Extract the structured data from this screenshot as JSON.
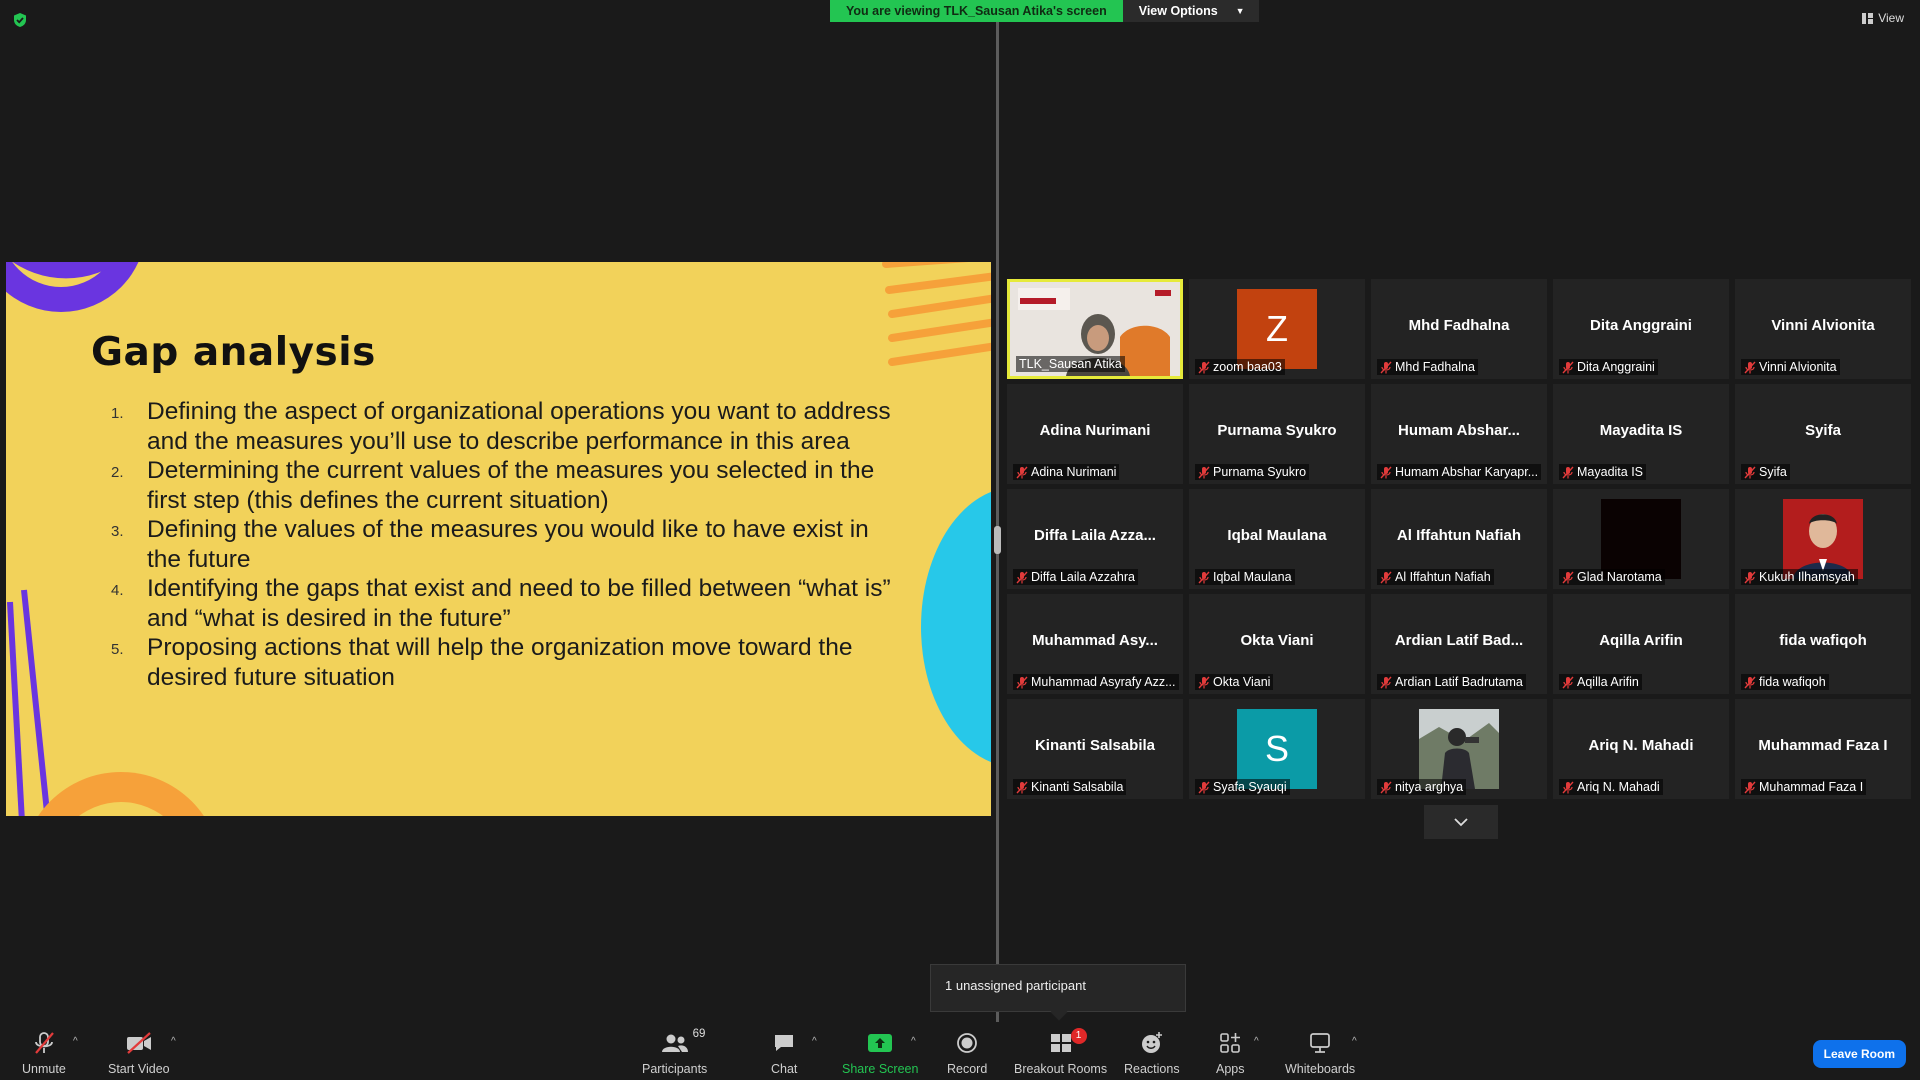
{
  "banner": {
    "viewing_text": "You are viewing TLK_Sausan Atika's screen",
    "view_options": "View Options"
  },
  "top_right": {
    "view_label": "View"
  },
  "slide": {
    "title": "Gap analysis",
    "items": [
      {
        "num": "1.",
        "text": "Defining the aspect of organizational operations you want to address and the measures you’ll use to describe performance in this area"
      },
      {
        "num": "2.",
        "text": "Determining the current values of the measures you selected in the first step (this defines the current situation)"
      },
      {
        "num": "3.",
        "text": "Defining the values of the measures you would like to have exist in the future"
      },
      {
        "num": "4.",
        "text": "Identifying the gaps that exist and need to be filled between “what is” and “what is desired in the future”"
      },
      {
        "num": "5.",
        "text": "Proposing actions that will help the organization move toward the desired future situation"
      }
    ]
  },
  "gallery": {
    "tiles": [
      {
        "big": "",
        "label": "TLK_Sausan Atika",
        "kind": "video"
      },
      {
        "big": "",
        "label": "zoom baa03",
        "kind": "letter",
        "letter": "Z",
        "color": "#c2420f"
      },
      {
        "big": "Mhd Fadhalna",
        "label": "Mhd Fadhalna",
        "kind": "name"
      },
      {
        "big": "Dita Anggraini",
        "label": "Dita Anggraini",
        "kind": "name"
      },
      {
        "big": "Vinni Alvionita",
        "label": "Vinni Alvionita",
        "kind": "name"
      },
      {
        "big": "Adina Nurimani",
        "label": "Adina Nurimani",
        "kind": "name"
      },
      {
        "big": "Purnama Syukro",
        "label": "Purnama Syukro",
        "kind": "name"
      },
      {
        "big": "Humam  Abshar...",
        "label": "Humam Abshar Karyapr...",
        "kind": "name"
      },
      {
        "big": "Mayadita IS",
        "label": "Mayadita IS",
        "kind": "name"
      },
      {
        "big": "Syifa",
        "label": "Syifa",
        "kind": "name"
      },
      {
        "big": "Diffa  Laila  Azza...",
        "label": "Diffa Laila Azzahra",
        "kind": "name"
      },
      {
        "big": "Iqbal Maulana",
        "label": "Iqbal Maulana",
        "kind": "name"
      },
      {
        "big": "Al Iffahtun Nafiah",
        "label": "Al Iffahtun Nafiah",
        "kind": "name"
      },
      {
        "big": "",
        "label": "Glad Narotama",
        "kind": "black"
      },
      {
        "big": "",
        "label": "Kukuh Ilhamsyah",
        "kind": "photo-red"
      },
      {
        "big": "Muhammad  Asy...",
        "label": "Muhammad Asyrafy Azz...",
        "kind": "name"
      },
      {
        "big": "Okta Viani",
        "label": "Okta Viani",
        "kind": "name"
      },
      {
        "big": "Ardian  Latif  Bad...",
        "label": "Ardian Latif Badrutama",
        "kind": "name"
      },
      {
        "big": "Aqilla Arifin",
        "label": "Aqilla Arifin",
        "kind": "name"
      },
      {
        "big": "fida wafiqoh",
        "label": "fida wafiqoh",
        "kind": "name"
      },
      {
        "big": "Kinanti Salsabila",
        "label": "Kinanti Salsabila",
        "kind": "name"
      },
      {
        "big": "",
        "label": "Syafa Syauqi",
        "kind": "letter",
        "letter": "S",
        "color": "#0b9ba7"
      },
      {
        "big": "",
        "label": "nitya arghya",
        "kind": "photo-outdoor"
      },
      {
        "big": "Ariq N. Mahadi",
        "label": "Ariq N. Mahadi",
        "kind": "name"
      },
      {
        "big": "Muhammad Faza I",
        "label": "Muhammad Faza I",
        "kind": "name"
      }
    ]
  },
  "toast": "1 unassigned participant",
  "toolbar": {
    "unmute": "Unmute",
    "start_video": "Start Video",
    "participants": "Participants",
    "participants_count": "69",
    "chat": "Chat",
    "share_screen": "Share Screen",
    "record": "Record",
    "breakout_rooms": "Breakout Rooms",
    "breakout_badge": "1",
    "reactions": "Reactions",
    "apps": "Apps",
    "whiteboards": "Whiteboards",
    "leave_room": "Leave Room"
  },
  "colors": {
    "share_green": "#23c552",
    "leave_blue": "#0e71eb",
    "active_speaker": "#e6ea3a",
    "slide_bg": "#f2d25a"
  }
}
